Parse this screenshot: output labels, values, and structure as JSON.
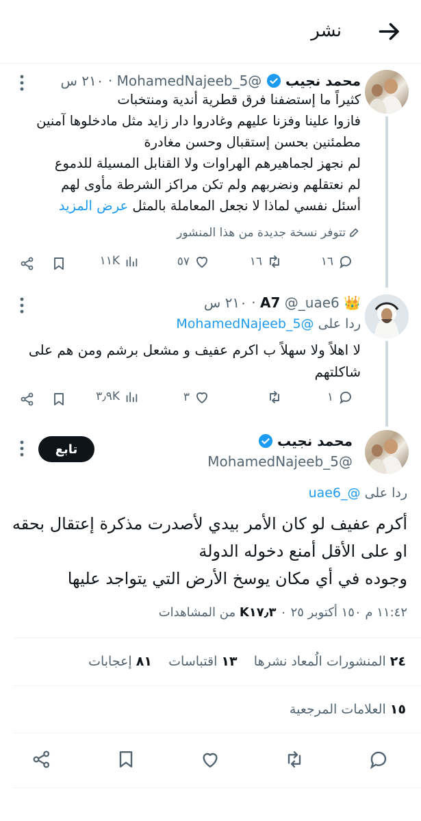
{
  "header": {
    "title": "نشر"
  },
  "tweet1": {
    "name": "محمد نجيب",
    "handle": "@MohamedNajeeb_5",
    "time": "٢١٠ س",
    "lines": [
      "كثيراً ما إستضفنا فرق قطرية أندية ومنتخبات",
      "فازوا علينا وفزنا عليهم  وغادروا دار زايد مثل مادخلوها آمنين",
      "مطمئنين بحسن إستقبال وحسن مغادرة",
      "لم نجهز لجماهيرهم الهراوات ولا القنابل المسيلة للدموع",
      "لم نعتقلهم ونضربهم ولم تكن مراكز الشرطة مأوى لهم",
      "أسئل نفسي لماذا لا نجعل المعاملة بالمثل"
    ],
    "show_more": "عرض المزيد",
    "edited_note": "تتوفر نسخة جديدة من هذا المنشور",
    "replies": "١٦",
    "reposts": "١٦",
    "likes": "٥٧",
    "views": "١١K"
  },
  "tweet2": {
    "name": "A7",
    "crown": "👑",
    "handle": "@_uae6",
    "time": "٢١٠ س",
    "reply_to_prefix": "ردا على",
    "reply_to_handle": "@MohamedNajeeb_5",
    "lines": [
      "لا اهلاً ولا سهلاً ب اكرم عفيف و مشعل برشم ومن هم على",
      "شاكلتهم"
    ],
    "replies": "١",
    "likes": "٣",
    "views": "٣٫٩K"
  },
  "main": {
    "name": "محمد نجيب",
    "handle": "@MohamedNajeeb_5",
    "follow_label": "تابع",
    "reply_to_prefix": "ردا على",
    "reply_to_handle": "@_uae6",
    "lines": [
      "أكرم عفيف لو كان الأمر بيدي لأصدرت مذكرة إعتقال بحقه",
      "او على الأقل أمنع دخوله الدولة",
      "وجوده في أي مكان يوسخ الأرض التي يتواجد عليها"
    ],
    "meta": "١١:٤٢ م ١٥٠ أكتوبر ٢٥ ٠ ",
    "views_count": "K١٧٫٣",
    "views_label": "من المشاهدات",
    "reposts_count": "٢٤",
    "reposts_label": "المنشورات الُمعاد نشرها",
    "quotes_count": "١٣",
    "quotes_label": "اقتباسات",
    "likes_count": "٨١",
    "likes_label": "إعجابات",
    "bookmarks_count": "١٥",
    "bookmarks_label": "العلامات المرجعية"
  },
  "icons": [
    "arrow-back-icon",
    "verified-icon",
    "more-icon",
    "reply-icon",
    "repost-icon",
    "like-icon",
    "views-icon",
    "bookmark-icon",
    "share-icon",
    "edit-icon"
  ],
  "colors": {
    "link": "#1d9bf0",
    "verified": "#1d9bf0",
    "muted": "#536471",
    "text": "#0f1419"
  }
}
